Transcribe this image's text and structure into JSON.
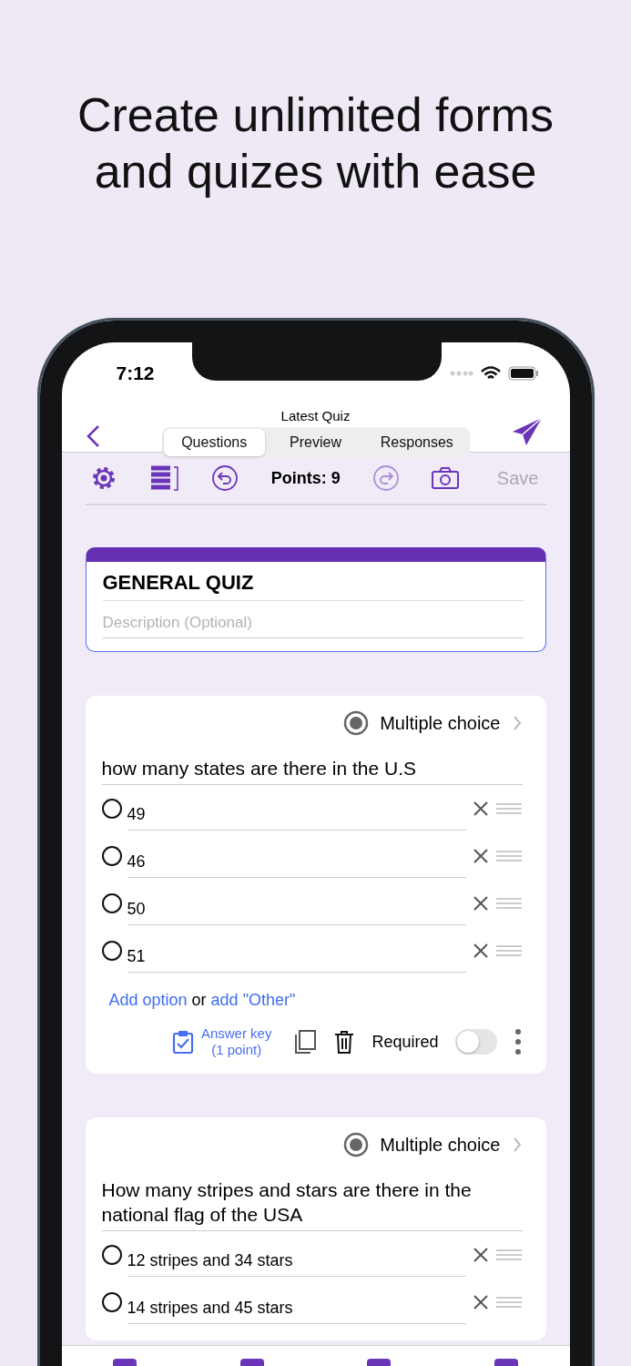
{
  "headline": "Create unlimited forms and quizes with ease",
  "status_bar": {
    "time": "7:12"
  },
  "nav": {
    "title": "Latest Quiz",
    "tabs": [
      {
        "label": "Questions",
        "selected": true
      },
      {
        "label": "Preview",
        "selected": false
      },
      {
        "label": "Responses",
        "selected": false
      }
    ]
  },
  "toolbar": {
    "points": "Points: 9",
    "redo_disabled": true,
    "save": {
      "label": "Save",
      "disabled": true
    }
  },
  "form": {
    "title": "GENERAL QUIZ",
    "description_placeholder": "Description (Optional)"
  },
  "questions": [
    {
      "type_label": "Multiple choice",
      "text": "how many states are there in the U.S",
      "options": [
        {
          "label": "49",
          "selected": false
        },
        {
          "label": "46",
          "selected": false
        },
        {
          "label": "50",
          "selected": false
        },
        {
          "label": "51",
          "selected": false
        }
      ],
      "add_option": "Add option",
      "or": "or",
      "add_other": "add \"Other\"",
      "footer": {
        "answer_key": "Answer key",
        "points": "(1 point)",
        "required_label": "Required",
        "required": false
      }
    },
    {
      "type_label": "Multiple choice",
      "text": "How many stripes and stars are there in the national flag of the USA",
      "options": [
        {
          "label": "12 stripes and 34 stars",
          "selected": false
        },
        {
          "label": "14 stripes and 45 stars",
          "selected": false
        }
      ]
    }
  ]
}
